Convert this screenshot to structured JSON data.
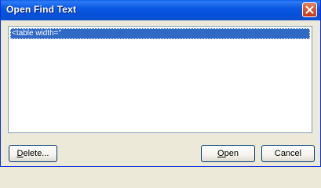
{
  "window": {
    "title": "Open Find Text",
    "close_icon": "close-icon"
  },
  "list": {
    "items": [
      {
        "label": "<table width=\"",
        "selected": true
      }
    ]
  },
  "buttons": {
    "delete": {
      "mnemonic": "D",
      "rest": "elete..."
    },
    "open": {
      "mnemonic": "O",
      "rest": "pen"
    },
    "cancel": {
      "mnemonic": "",
      "rest": "Cancel"
    }
  },
  "colors": {
    "titlebar": "#0b58e3",
    "selection": "#316ac5",
    "close": "#d65a32",
    "window_bg": "#ece9d8"
  }
}
